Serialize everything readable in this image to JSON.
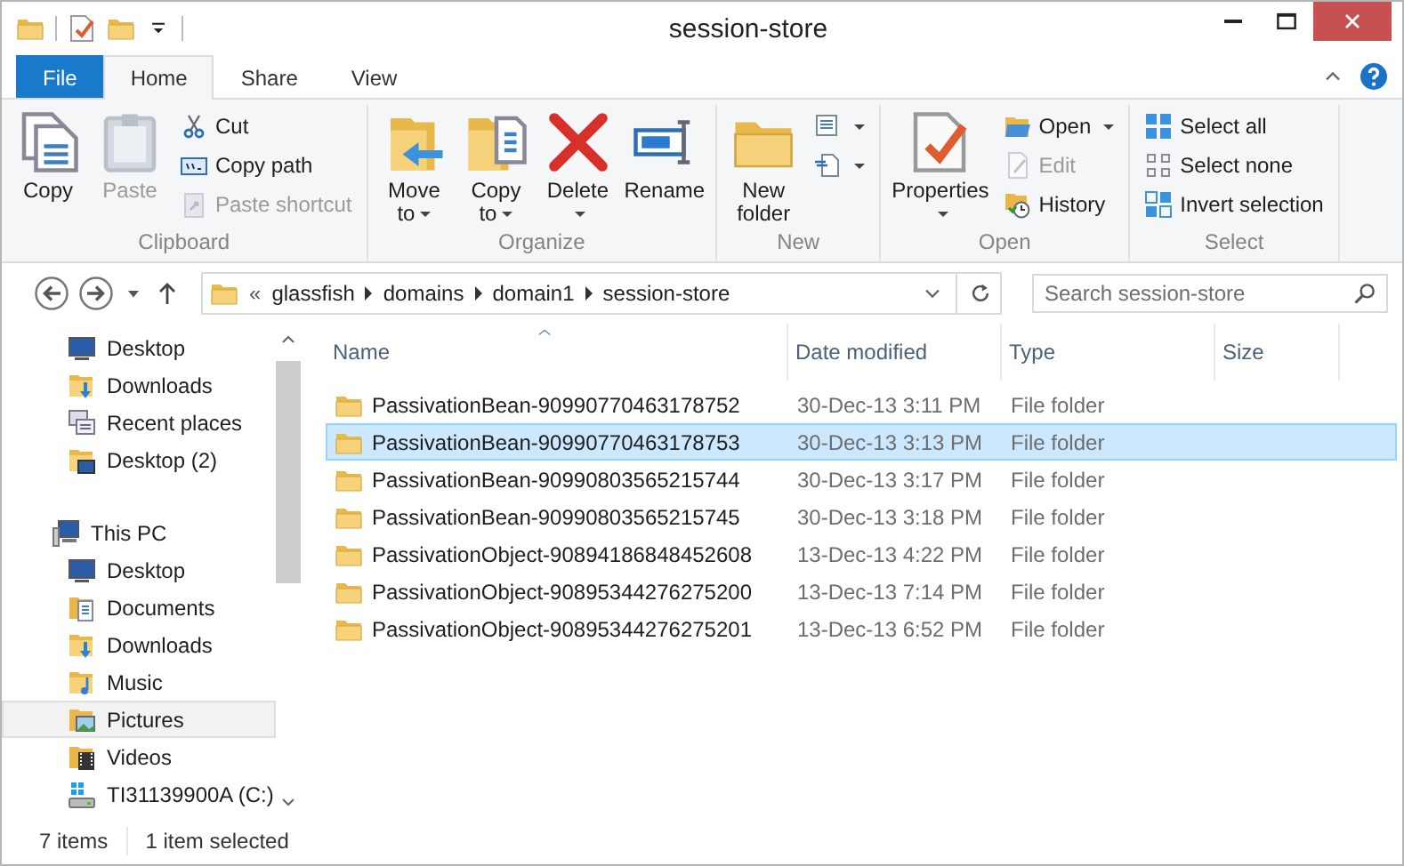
{
  "window": {
    "title": "session-store"
  },
  "tabs": [
    {
      "label": "File",
      "kind": "file",
      "selected": false
    },
    {
      "label": "Home",
      "kind": "tab",
      "selected": true
    },
    {
      "label": "Share",
      "kind": "tab",
      "selected": false
    },
    {
      "label": "View",
      "kind": "tab",
      "selected": false
    }
  ],
  "ribbon": {
    "groups": [
      {
        "label": "Clipboard",
        "items": [
          {
            "kind": "large",
            "label": "Copy",
            "disabled": false,
            "dropdown": false
          },
          {
            "kind": "large",
            "label": "Paste",
            "disabled": true,
            "dropdown": false
          },
          {
            "kind": "stack",
            "items": [
              {
                "label": "Cut",
                "disabled": false,
                "dropdown": false
              },
              {
                "label": "Copy path",
                "disabled": false,
                "dropdown": false
              },
              {
                "label": "Paste shortcut",
                "disabled": true,
                "dropdown": false
              }
            ]
          }
        ]
      },
      {
        "label": "Organize",
        "items": [
          {
            "kind": "large",
            "label": "Move to",
            "disabled": false,
            "dropdown": true
          },
          {
            "kind": "large",
            "label": "Copy to",
            "disabled": false,
            "dropdown": true
          },
          {
            "kind": "large",
            "label": "Delete",
            "disabled": false,
            "dropdown": true
          },
          {
            "kind": "large",
            "label": "Rename",
            "disabled": false,
            "dropdown": false
          }
        ]
      },
      {
        "label": "New",
        "items": [
          {
            "kind": "large",
            "label": "New folder",
            "disabled": false,
            "dropdown": false
          },
          {
            "kind": "stack",
            "items": [
              {
                "disabled": false,
                "dropdown": true
              },
              {
                "disabled": false,
                "dropdown": true
              }
            ]
          }
        ]
      },
      {
        "label": "Open",
        "items": [
          {
            "kind": "large",
            "label": "Properties",
            "disabled": false,
            "dropdown": true
          },
          {
            "kind": "stack",
            "items": [
              {
                "label": "Open",
                "disabled": false,
                "dropdown": true
              },
              {
                "label": "Edit",
                "disabled": true,
                "dropdown": false
              },
              {
                "label": "History",
                "disabled": false,
                "dropdown": false
              }
            ]
          }
        ]
      },
      {
        "label": "Select",
        "items": [
          {
            "kind": "stack",
            "items": [
              {
                "label": "Select all",
                "disabled": false,
                "dropdown": false
              },
              {
                "label": "Select none",
                "disabled": false,
                "dropdown": false
              },
              {
                "label": "Invert selection",
                "disabled": false,
                "dropdown": false
              }
            ]
          }
        ]
      }
    ]
  },
  "address": {
    "overflow": "«",
    "crumbs": [
      "glassfish",
      "domains",
      "domain1",
      "session-store"
    ]
  },
  "search": {
    "placeholder": "Search session-store"
  },
  "sidebar": {
    "quick_access": [
      {
        "label": "Desktop",
        "selected": false
      },
      {
        "label": "Downloads",
        "selected": false
      },
      {
        "label": "Recent places",
        "selected": false
      },
      {
        "label": "Desktop (2)",
        "selected": false
      }
    ],
    "this_pc": {
      "label": "This PC",
      "selected": false,
      "children": [
        {
          "label": "Desktop",
          "selected": false
        },
        {
          "label": "Documents",
          "selected": false
        },
        {
          "label": "Downloads",
          "selected": false
        },
        {
          "label": "Music",
          "selected": false
        },
        {
          "label": "Pictures",
          "selected": true
        },
        {
          "label": "Videos",
          "selected": false
        },
        {
          "label": "TI31139900A (C:)",
          "selected": false
        }
      ]
    }
  },
  "table": {
    "columns": [
      {
        "label": "Name",
        "sorted": true
      },
      {
        "label": "Date modified",
        "sorted": false
      },
      {
        "label": "Type",
        "sorted": false
      },
      {
        "label": "Size",
        "sorted": false
      }
    ],
    "rows": [
      {
        "name": "PassivationBean-90990770463178752",
        "date": "30-Dec-13 3:11 PM",
        "type": "File folder",
        "selected": false
      },
      {
        "name": "PassivationBean-90990770463178753",
        "date": "30-Dec-13 3:13 PM",
        "type": "File folder",
        "selected": true
      },
      {
        "name": "PassivationBean-90990803565215744",
        "date": "30-Dec-13 3:17 PM",
        "type": "File folder",
        "selected": false
      },
      {
        "name": "PassivationBean-90990803565215745",
        "date": "30-Dec-13 3:18 PM",
        "type": "File folder",
        "selected": false
      },
      {
        "name": "PassivationObject-90894186848452608",
        "date": "13-Dec-13 4:22 PM",
        "type": "File folder",
        "selected": false
      },
      {
        "name": "PassivationObject-90895344276275200",
        "date": "13-Dec-13 7:14 PM",
        "type": "File folder",
        "selected": false
      },
      {
        "name": "PassivationObject-90895344276275201",
        "date": "13-Dec-13 6:52 PM",
        "type": "File folder",
        "selected": false
      }
    ]
  },
  "status_bar": {
    "count": "7 items",
    "selection": "1 item selected"
  }
}
